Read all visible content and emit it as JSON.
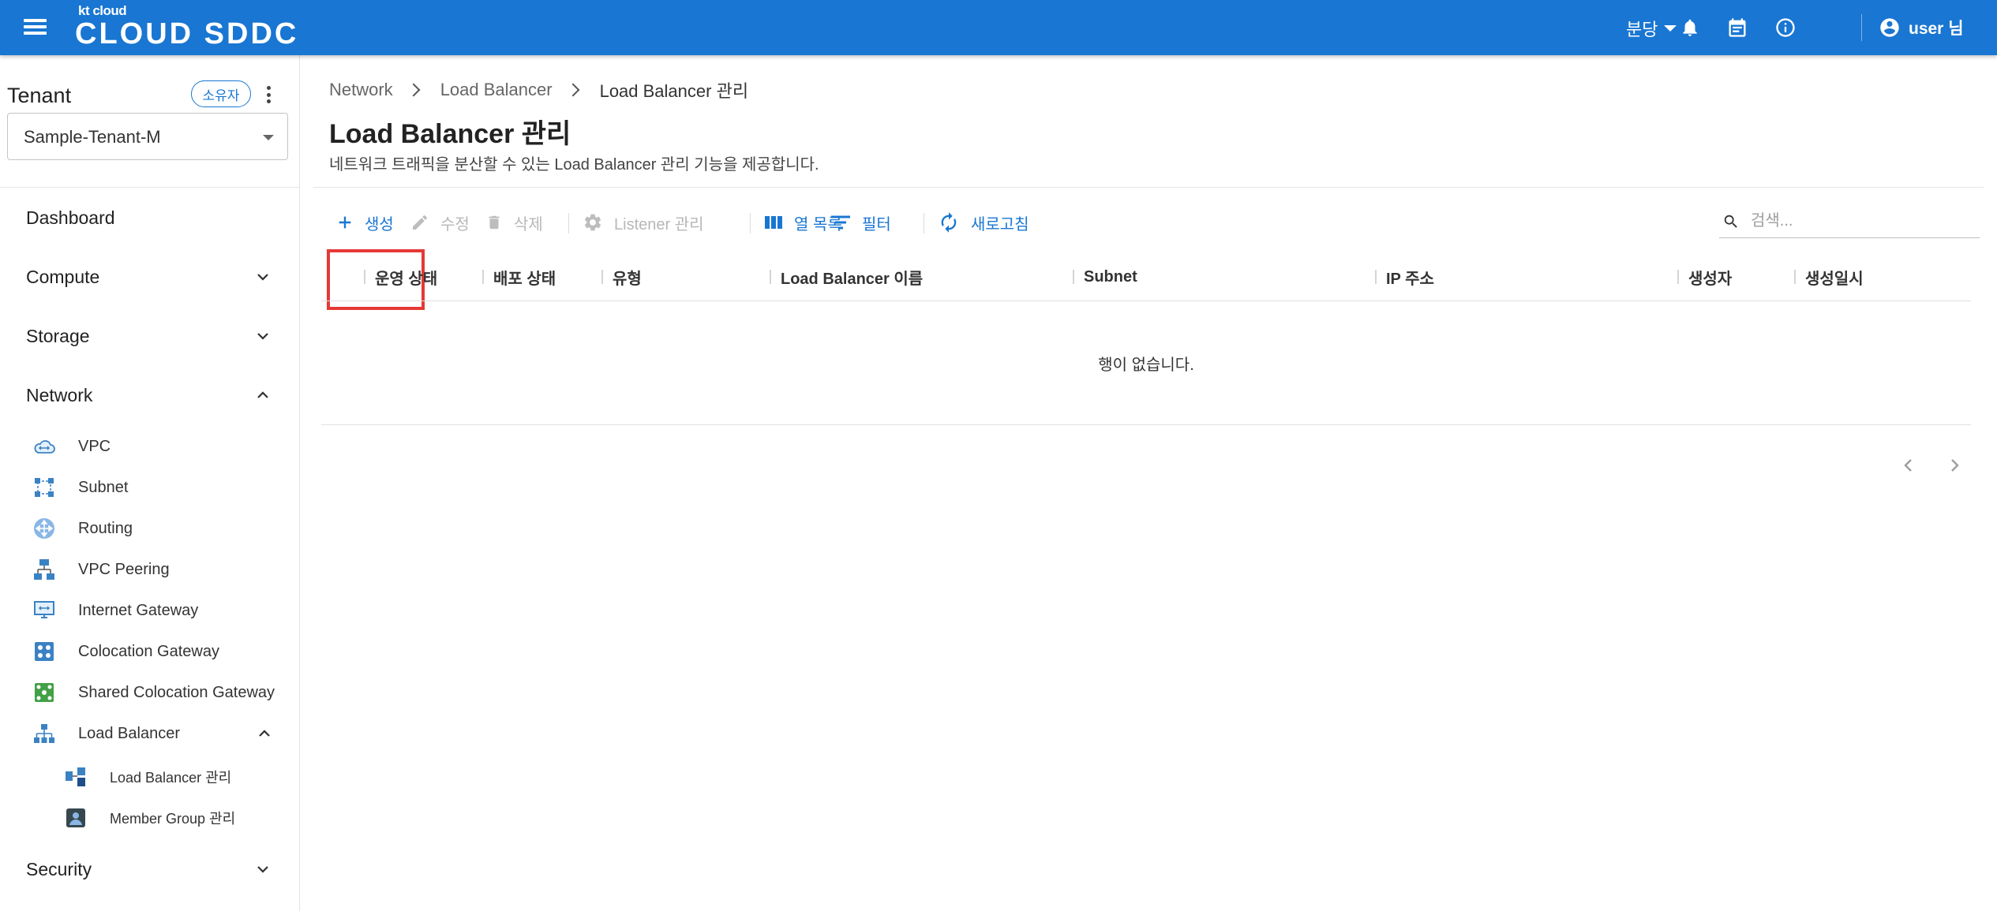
{
  "header": {
    "logo_small": "kt cloud",
    "logo_main": "CLOUD SDDC",
    "branch": "분당",
    "user": "user 님",
    "colors": {
      "primary": "#1976d2",
      "highlight": "#e53935"
    },
    "icons": [
      "menu-icon",
      "bell-icon",
      "calendar-icon",
      "info-icon",
      "account-circle-icon"
    ]
  },
  "sidebar": {
    "tenant_label": "Tenant",
    "owner_badge": "소유자",
    "tenant_value": "Sample-Tenant-M",
    "nav": {
      "dashboard": "Dashboard",
      "compute": "Compute",
      "storage": "Storage",
      "network": "Network",
      "security": "Security"
    },
    "network_items": [
      {
        "label": "VPC",
        "icon": "vpc-cloud-icon"
      },
      {
        "label": "Subnet",
        "icon": "subnet-icon"
      },
      {
        "label": "Routing",
        "icon": "routing-icon"
      },
      {
        "label": "VPC Peering",
        "icon": "vpc-peering-icon"
      },
      {
        "label": "Internet Gateway",
        "icon": "internet-gateway-icon"
      },
      {
        "label": "Colocation Gateway",
        "icon": "colocation-gateway-icon"
      },
      {
        "label": "Shared Colocation Gateway",
        "icon": "shared-colocation-gateway-icon"
      },
      {
        "label": "Load Balancer",
        "icon": "load-balancer-icon"
      }
    ],
    "lb_items": [
      {
        "label": "Load Balancer 관리",
        "icon": "load-balancer-manage-icon"
      },
      {
        "label": "Member Group 관리",
        "icon": "member-group-icon"
      }
    ]
  },
  "main": {
    "breadcrumb": [
      "Network",
      "Load Balancer",
      "Load Balancer 관리"
    ],
    "title": "Load Balancer 관리",
    "description": "네트워크 트래픽을 분산할 수 있는 Load Balancer 관리 기능을 제공합니다.",
    "toolbar": {
      "create": "생성",
      "edit": "수정",
      "delete": "삭제",
      "listener": "Listener 관리",
      "columns": "열 목록",
      "filter": "필터",
      "refresh": "새로고침"
    },
    "search_placeholder": "검색...",
    "columns": [
      "운영 상태",
      "배포 상태",
      "유형",
      "Load Balancer 이름",
      "Subnet",
      "IP 주소",
      "생성자",
      "생성일시"
    ],
    "empty_text": "행이 없습니다."
  }
}
